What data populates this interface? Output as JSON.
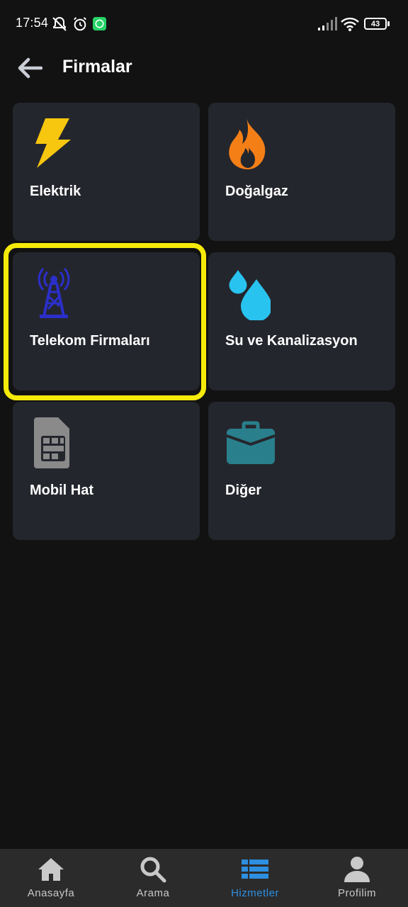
{
  "status_bar": {
    "time": "17:54",
    "battery": "43"
  },
  "header": {
    "title": "Firmalar"
  },
  "cards": [
    {
      "label": "Elektrik",
      "icon": "lightning-bolt-icon",
      "color": "#f7c60e"
    },
    {
      "label": "Doğalgaz",
      "icon": "flame-icon",
      "color": "#f57f17"
    },
    {
      "label": "Telekom Firmaları",
      "icon": "signal-tower-icon",
      "color": "#2b2fc9",
      "highlighted": true
    },
    {
      "label": "Su ve Kanalizasyon",
      "icon": "water-drops-icon",
      "color": "#29c3ef"
    },
    {
      "label": "Mobil Hat",
      "icon": "sim-card-icon",
      "color": "#8a8a8a"
    },
    {
      "label": "Diğer",
      "icon": "briefcase-icon",
      "color": "#2a7f8c"
    }
  ],
  "bottom_nav": {
    "items": [
      {
        "label": "Anasayfa",
        "icon": "home-icon"
      },
      {
        "label": "Arama",
        "icon": "search-icon"
      },
      {
        "label": "Hizmetler",
        "icon": "list-icon",
        "active": true
      },
      {
        "label": "Profilim",
        "icon": "user-icon"
      }
    ]
  },
  "colors": {
    "background": "#121212",
    "card": "#24262d",
    "highlight": "#f5ea0a",
    "nav_active": "#2d8fe0",
    "nav": "#2b2b2b"
  }
}
